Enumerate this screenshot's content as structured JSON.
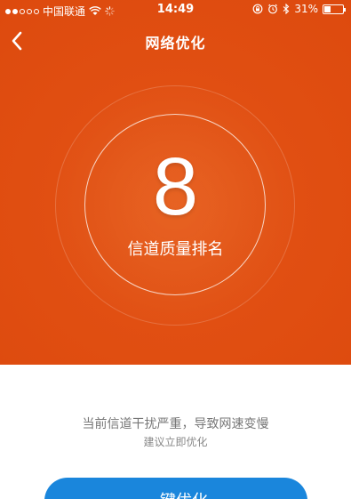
{
  "status_bar": {
    "carrier": "中国联通",
    "time": "14:49",
    "battery": "31%",
    "battery_level": 0.31,
    "signal_bars": 2
  },
  "nav": {
    "title": "网络优化",
    "back_icon": "chevron-left-icon"
  },
  "gauge": {
    "rank": "8",
    "label": "信道质量排名"
  },
  "message": {
    "main": "当前信道干扰严重，导致网速变慢",
    "sub": "建议立即优化"
  },
  "action": {
    "optimize_label": "一键优化"
  },
  "colors": {
    "accent": "#e14f12",
    "button": "#1a86dc"
  }
}
